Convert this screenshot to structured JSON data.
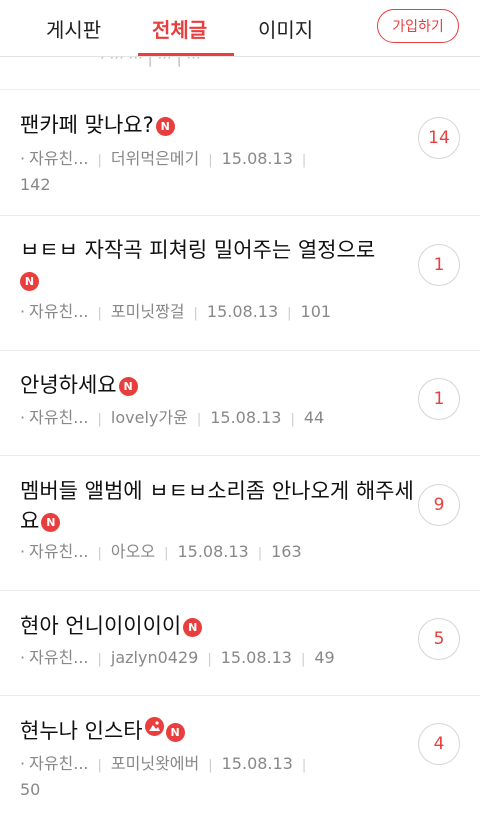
{
  "header": {
    "tabs": [
      {
        "label": "게시판"
      },
      {
        "label": "전체글"
      },
      {
        "label": "이미지"
      }
    ],
    "join_label": "가입하기"
  },
  "new_badge": "N",
  "posts": [
    {
      "title": "팬카페 맞나요?",
      "board": "자유친...",
      "author": "더위먹은메기",
      "date": "15.08.13",
      "views": "142",
      "comments": "14"
    },
    {
      "title": "ㅂㅌㅂ 자작곡 피쳐링 밀어주는 열정으로",
      "board": "자유친...",
      "author": "포미닛짱걸",
      "date": "15.08.13",
      "views": "101",
      "comments": "1"
    },
    {
      "title": "안녕하세요",
      "board": "자유친...",
      "author": "lovely가윤",
      "date": "15.08.13",
      "views": "44",
      "comments": "1"
    },
    {
      "title": "멤버들 앨범에 ㅂㅌㅂ소리좀 안나오게 해주세요",
      "board": "자유친...",
      "author": "아오오",
      "date": "15.08.13",
      "views": "163",
      "comments": "9"
    },
    {
      "title": "현아 언니이이이이",
      "board": "자유친...",
      "author": "jazlyn0429",
      "date": "15.08.13",
      "views": "49",
      "comments": "5"
    },
    {
      "title": "현누나 인스타",
      "board": "자유친...",
      "author": "포미닛왓에버",
      "date": "15.08.13",
      "views": "50",
      "comments": "4"
    }
  ],
  "colors": {
    "accent": "#e83e3e",
    "meta": "#888888",
    "divider": "#ececec"
  }
}
